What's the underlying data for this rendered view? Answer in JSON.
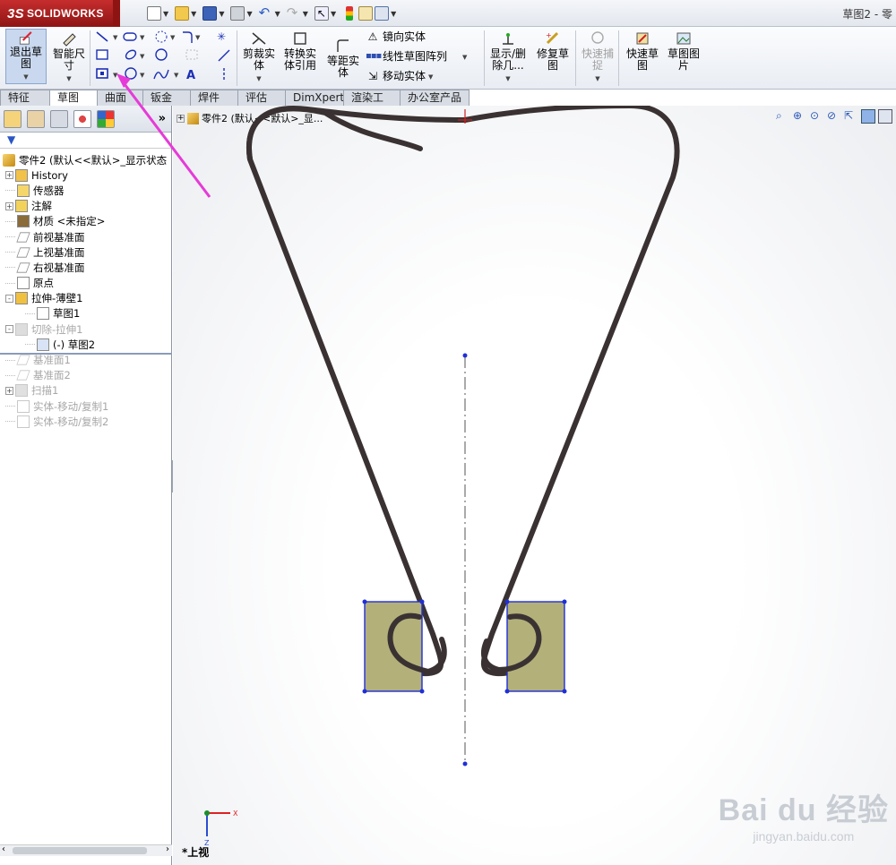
{
  "app": {
    "brand": "SOLIDWORKS",
    "brand_prefix": "3S",
    "document_title": "草图2 - 零"
  },
  "commands": {
    "exit_sketch": "退出草图",
    "smart_dimension": "智能尺寸",
    "trim": "剪裁实体",
    "convert": "转换实体引用",
    "offset": "等距实体",
    "mirror": "镜向实体",
    "linear_pattern": "线性草图阵列",
    "move": "移动实体",
    "display_delete": "显示/删除几...",
    "repair": "修复草图",
    "quick_snaps": "快速捕捉",
    "rapid_sketch": "快速草图",
    "sketch_picture": "草图图片"
  },
  "tabs": [
    {
      "label": "特征",
      "active": false
    },
    {
      "label": "草图",
      "active": true
    },
    {
      "label": "曲面",
      "active": false
    },
    {
      "label": "钣金",
      "active": false
    },
    {
      "label": "焊件",
      "active": false
    },
    {
      "label": "评估",
      "active": false
    },
    {
      "label": "DimXpert",
      "active": false
    },
    {
      "label": "渲染工具",
      "active": false
    },
    {
      "label": "办公室产品",
      "active": false
    }
  ],
  "tree": {
    "root": "零件2 (默认<<默认>_显示状态",
    "items": [
      {
        "label": "History",
        "expander": "+",
        "dim": false,
        "indent": 1,
        "icon": "history-icon"
      },
      {
        "label": "传感器",
        "expander": "",
        "dim": false,
        "indent": 1,
        "icon": "sensor-icon"
      },
      {
        "label": "注解",
        "expander": "+",
        "dim": false,
        "indent": 1,
        "icon": "annotation-icon"
      },
      {
        "label": "材质 <未指定>",
        "expander": "",
        "dim": false,
        "indent": 1,
        "icon": "material-icon"
      },
      {
        "label": "前视基准面",
        "expander": "",
        "dim": false,
        "indent": 1,
        "icon": "plane-icon"
      },
      {
        "label": "上视基准面",
        "expander": "",
        "dim": false,
        "indent": 1,
        "icon": "plane-icon"
      },
      {
        "label": "右视基准面",
        "expander": "",
        "dim": false,
        "indent": 1,
        "icon": "plane-icon"
      },
      {
        "label": "原点",
        "expander": "",
        "dim": false,
        "indent": 1,
        "icon": "origin-icon"
      },
      {
        "label": "拉伸-薄壁1",
        "expander": "-",
        "dim": false,
        "indent": 1,
        "icon": "extrude-icon"
      },
      {
        "label": "草图1",
        "expander": "",
        "dim": false,
        "indent": 2,
        "icon": "sketch-icon"
      },
      {
        "label": "切除-拉伸1",
        "expander": "-",
        "dim": true,
        "indent": 1,
        "icon": "cut-icon"
      },
      {
        "label": "(-) 草图2",
        "expander": "",
        "dim": false,
        "indent": 2,
        "icon": "sketch-edit-icon"
      },
      {
        "label": "基准面1",
        "expander": "",
        "dim": true,
        "indent": 1,
        "icon": "plane-icon"
      },
      {
        "label": "基准面2",
        "expander": "",
        "dim": true,
        "indent": 1,
        "icon": "plane-icon"
      },
      {
        "label": "扫描1",
        "expander": "+",
        "dim": true,
        "indent": 1,
        "icon": "sweep-icon"
      },
      {
        "label": "实体-移动/复制1",
        "expander": "",
        "dim": true,
        "indent": 1,
        "icon": "move-copy-icon"
      },
      {
        "label": "实体-移动/复制2",
        "expander": "",
        "dim": true,
        "indent": 1,
        "icon": "move-copy-icon"
      }
    ]
  },
  "viewport": {
    "title": "零件2 (默认<<默认>_显...",
    "view_name": "*上视",
    "triad_x": "X",
    "triad_z": "Z"
  },
  "watermark": {
    "line1": "Bai du 经验",
    "line2": "jingyan.baidu.com"
  },
  "colors": {
    "accent_red": "#b81c1c",
    "sketch_blue": "#1f2fd8",
    "region_fill": "#b3b07a",
    "body_stroke": "#3a3232",
    "arrow_magenta": "#e63ad8"
  }
}
